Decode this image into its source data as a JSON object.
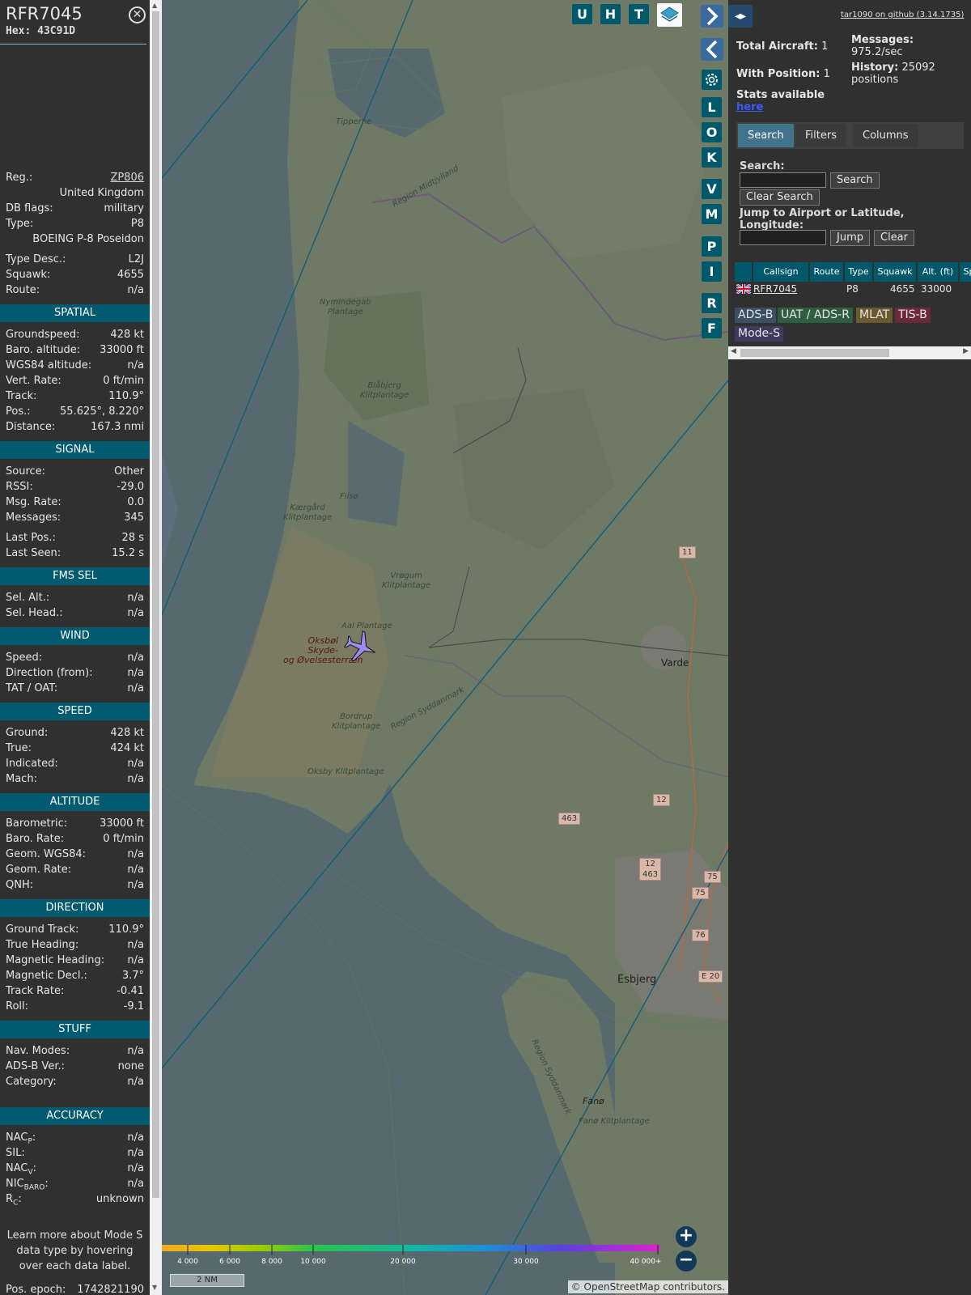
{
  "info": {
    "callsign": "RFR7045",
    "hex_label": "Hex:",
    "hex": "43C91D",
    "close_glyph": "⊗",
    "rows_top": [
      {
        "label": "Reg.:",
        "value": "ZP806",
        "link": true
      },
      {
        "label": "",
        "value": "United Kingdom"
      },
      {
        "label": "DB flags:",
        "value": "military"
      },
      {
        "label": "Type:",
        "value": "P8"
      },
      {
        "label": "",
        "value": "BOEING P-8 Poseidon",
        "gap_after": true
      },
      {
        "label": "Type Desc.:",
        "value": "L2J"
      },
      {
        "label": "Squawk:",
        "value": "4655"
      },
      {
        "label": "Route:",
        "value": "n/a"
      }
    ],
    "sections": [
      {
        "title": "SPATIAL",
        "rows": [
          {
            "label": "Groundspeed:",
            "value": "428 kt"
          },
          {
            "label": "Baro. altitude:",
            "value": "33000 ft"
          },
          {
            "label": "WGS84 altitude:",
            "value": "n/a"
          },
          {
            "label": "Vert. Rate:",
            "value": "0 ft/min"
          },
          {
            "label": "Track:",
            "value": "110.9°"
          },
          {
            "label": "Pos.:",
            "value": "55.625°, 8.220°"
          },
          {
            "label": "Distance:",
            "value": "167.3 nmi"
          }
        ]
      },
      {
        "title": "SIGNAL",
        "rows": [
          {
            "label": "Source:",
            "value": "Other"
          },
          {
            "label": "RSSI:",
            "value": "-29.0"
          },
          {
            "label": "Msg. Rate:",
            "value": "0.0"
          },
          {
            "label": "Messages:",
            "value": "345",
            "gap_after": true
          },
          {
            "label": "Last Pos.:",
            "value": "28 s"
          },
          {
            "label": "Last Seen:",
            "value": "15.2 s"
          }
        ]
      },
      {
        "title": "FMS SEL",
        "rows": [
          {
            "label": "Sel. Alt.:",
            "value": "n/a"
          },
          {
            "label": "Sel. Head.:",
            "value": "n/a"
          }
        ]
      },
      {
        "title": "WIND",
        "rows": [
          {
            "label": "Speed:",
            "value": "n/a"
          },
          {
            "label": "Direction (from):",
            "value": "n/a"
          },
          {
            "label": "TAT / OAT:",
            "value": "n/a"
          }
        ]
      },
      {
        "title": "SPEED",
        "rows": [
          {
            "label": "Ground:",
            "value": "428 kt"
          },
          {
            "label": "True:",
            "value": "424 kt"
          },
          {
            "label": "Indicated:",
            "value": "n/a"
          },
          {
            "label": "Mach:",
            "value": "n/a"
          }
        ]
      },
      {
        "title": "ALTITUDE",
        "rows": [
          {
            "label": "Barometric:",
            "value": "33000 ft"
          },
          {
            "label": "Baro. Rate:",
            "value": "0 ft/min"
          },
          {
            "label": "Geom. WGS84:",
            "value": "n/a"
          },
          {
            "label": "Geom. Rate:",
            "value": "n/a"
          },
          {
            "label": "QNH:",
            "value": "n/a"
          }
        ]
      },
      {
        "title": "DIRECTION",
        "rows": [
          {
            "label": "Ground Track:",
            "value": "110.9°"
          },
          {
            "label": "True Heading:",
            "value": "n/a"
          },
          {
            "label": "Magnetic Heading:",
            "value": "n/a"
          },
          {
            "label": "Magnetic Decl.:",
            "value": "3.7°"
          },
          {
            "label": "Track Rate:",
            "value": "-0.41"
          },
          {
            "label": "Roll:",
            "value": "-9.1"
          }
        ]
      },
      {
        "title": "STUFF",
        "rows": [
          {
            "label": "Nav. Modes:",
            "value": "n/a"
          },
          {
            "label": "ADS-B Ver.:",
            "value": "none"
          },
          {
            "label": "Category:",
            "value": "n/a"
          }
        ],
        "extra_gap": true
      },
      {
        "title": "ACCURACY",
        "rows": [
          {
            "label": "NACP:",
            "value": "n/a",
            "sub": "P",
            "base": "NAC"
          },
          {
            "label": "SIL:",
            "value": "n/a"
          },
          {
            "label": "NACV:",
            "value": "n/a",
            "sub": "V",
            "base": "NAC"
          },
          {
            "label": "NICBARO:",
            "value": "n/a",
            "sub": "BARO",
            "base": "NIC"
          },
          {
            "label": "RC:",
            "value": "unknown",
            "sub": "C",
            "base": "R"
          }
        ]
      }
    ],
    "note": "Learn more about Mode S data type by hovering over each data label.",
    "epoch_label": "Pos. epoch:",
    "epoch_value": "1742821190"
  },
  "map": {
    "buttons_top": [
      "U",
      "H",
      "T"
    ],
    "side_buttons": [
      "L",
      "O",
      "K",
      "V",
      "M",
      "P",
      "I",
      "R",
      "F"
    ],
    "places": [
      {
        "name": "Tipperne"
      },
      {
        "name": "Region Midtjylland"
      },
      {
        "name": "Nymindegab\nPlantage"
      },
      {
        "name": "Blåbjerg\nKlitplantage"
      },
      {
        "name": "Filsø"
      },
      {
        "name": "Kærgård\nKlitplantage"
      },
      {
        "name": "Vrøgum\nKlitplantage"
      },
      {
        "name": "Aal Plantage"
      },
      {
        "name": "Oksbøl\nSkyde-\nog Øvelsesterræn"
      },
      {
        "name": "Region Syddanmark"
      },
      {
        "name": "Bordrup\nKlitplantage"
      },
      {
        "name": "Oksby Klitplantage"
      },
      {
        "name": "Region Syddanmark"
      },
      {
        "name": "Fanø Klitplantage"
      }
    ],
    "towns": [
      "Varde",
      "Esbjerg",
      "Fanø"
    ],
    "shields": [
      "11",
      "12",
      "463",
      "12\n463",
      "75",
      "75",
      "76",
      "E 20"
    ],
    "legend_ticks": [
      "4 000",
      "6 000",
      "8 000",
      "10 000",
      "20 000",
      "30 000",
      "40 000+"
    ],
    "scale_label": "2 NM",
    "attribution_prefix": "© ",
    "attribution_link": "OpenStreetMap",
    "attribution_suffix": " contributors.",
    "zoom_in": "+",
    "zoom_out": "−"
  },
  "sidebar": {
    "github": "tar1090 on github (3.14.1735)",
    "total_aircraft_label": "Total Aircraft:",
    "total_aircraft": "1",
    "with_position_label": "With Position:",
    "with_position": "1",
    "messages_label": "Messages:",
    "messages_rate": "975.2/sec",
    "history_label": "History:",
    "history_value": "25092",
    "history_unit": "positions",
    "stats_label": "Stats available",
    "stats_link": "here",
    "tabs": [
      "Search",
      "Filters",
      "Columns"
    ],
    "search_label": "Search:",
    "search_button": "Search",
    "clear_search_button": "Clear Search",
    "jump_label": "Jump to Airport or Latitude, Longitude:",
    "jump_button": "Jump",
    "clear_button": "Clear",
    "table_headers": [
      "",
      "Callsign",
      "Route",
      "Type",
      "Squawk",
      "Alt. (ft)",
      "Spd"
    ],
    "table_row": {
      "callsign": "RFR7045",
      "route": "",
      "type": "P8",
      "squawk": "4655",
      "altitude": "33000"
    },
    "sources": [
      {
        "label": "ADS-B",
        "color": "#3b4f64"
      },
      {
        "label": "UAT / ADS-R",
        "color": "#2f5d3f"
      },
      {
        "label": "MLAT",
        "color": "#6b5a2e"
      },
      {
        "label": "TIS-B",
        "color": "#6a2a3a"
      },
      {
        "label": "Mode-S",
        "color": "#3e3a5e"
      }
    ]
  },
  "colors": {
    "accent": "#00596b",
    "panel": "#303030",
    "aircraft": "#9b8cf0"
  }
}
